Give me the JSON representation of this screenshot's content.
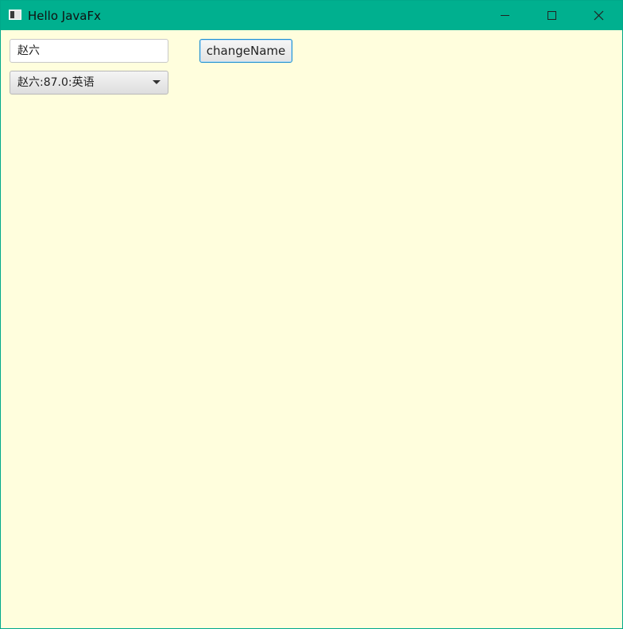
{
  "window": {
    "title": "Hello JavaFx",
    "title_bar_color": "#00b08f",
    "background_color": "#fffedd",
    "controls": {
      "minimize_icon": "minimize-icon",
      "maximize_icon": "maximize-icon",
      "close_icon": "close-icon"
    }
  },
  "form": {
    "name_field_value": "赵六",
    "change_button_label": "changeName",
    "combo_selected_value": "赵六:87.0:英语"
  }
}
